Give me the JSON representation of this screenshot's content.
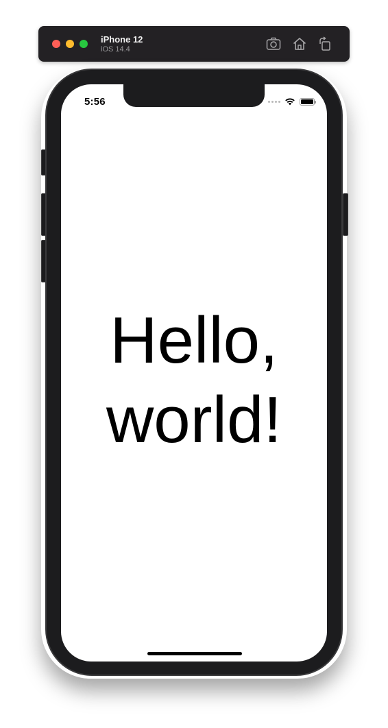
{
  "simulator": {
    "device_name": "iPhone 12",
    "os_version": "iOS 14.4",
    "toolbar_icons": [
      "screenshot-icon",
      "home-icon",
      "rotate-icon"
    ]
  },
  "status_bar": {
    "time": "5:56",
    "icons": [
      "signal-dots-icon",
      "wifi-icon",
      "battery-icon"
    ],
    "battery_level": 1.0
  },
  "content": {
    "text_line_1": "Hello,",
    "text_line_2": "world!"
  },
  "colors": {
    "toolbar_bg": "#232124",
    "close": "#fe5f57",
    "minimize": "#febc2e",
    "maximize": "#28c840",
    "device_frame": "#1c1c1e",
    "screen_bg": "#ffffff",
    "text": "#000000"
  }
}
